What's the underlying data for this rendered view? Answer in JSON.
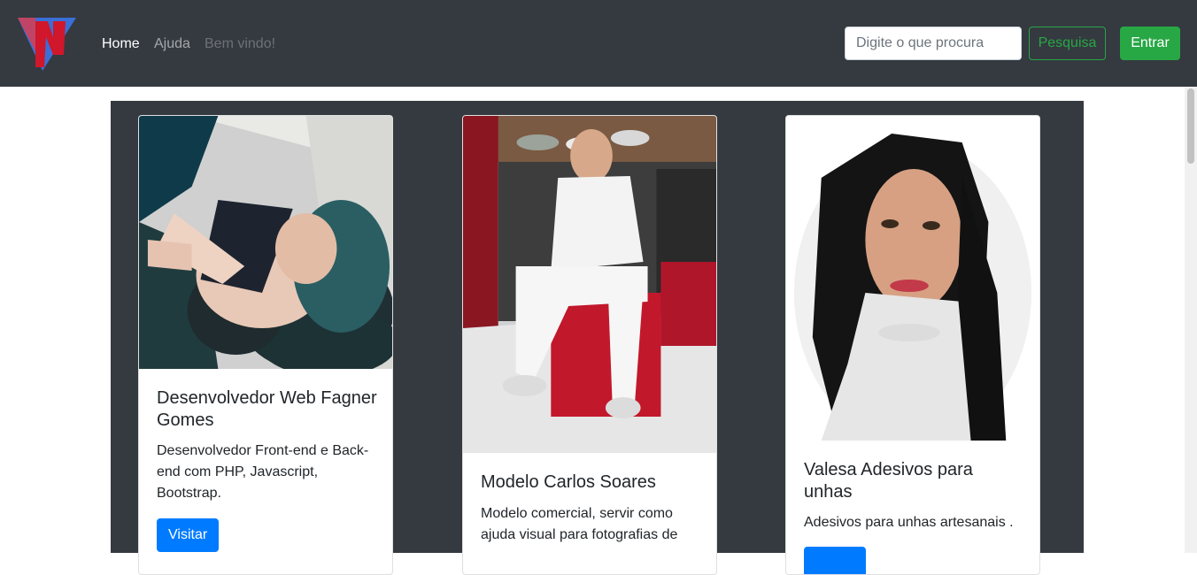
{
  "navbar": {
    "brand_logo": "triangle-logo-icon",
    "links": [
      {
        "label": "Home"
      },
      {
        "label": "Ajuda"
      },
      {
        "label": "Bem vindo!"
      }
    ],
    "search": {
      "placeholder": "Digite o que procura",
      "value": ""
    },
    "search_button": "Pesquisa",
    "login_button": "Entrar"
  },
  "colors": {
    "navbar_bg": "#343a40",
    "success": "#28a745",
    "primary": "#007bff"
  },
  "cards": [
    {
      "title": "Desenvolvedor Web Fagner Gomes",
      "text": "Desenvolvedor Front-end e Back-end com PHP, Javascript, Bootstrap.",
      "button": "Visitar"
    },
    {
      "title": "Modelo Carlos Soares",
      "text": "Modelo comercial, servir como ajuda visual para fotografias de",
      "button": ""
    },
    {
      "title": "Valesa Adesivos para unhas",
      "text": "Adesivos para unhas artesanais .",
      "button": ""
    }
  ]
}
